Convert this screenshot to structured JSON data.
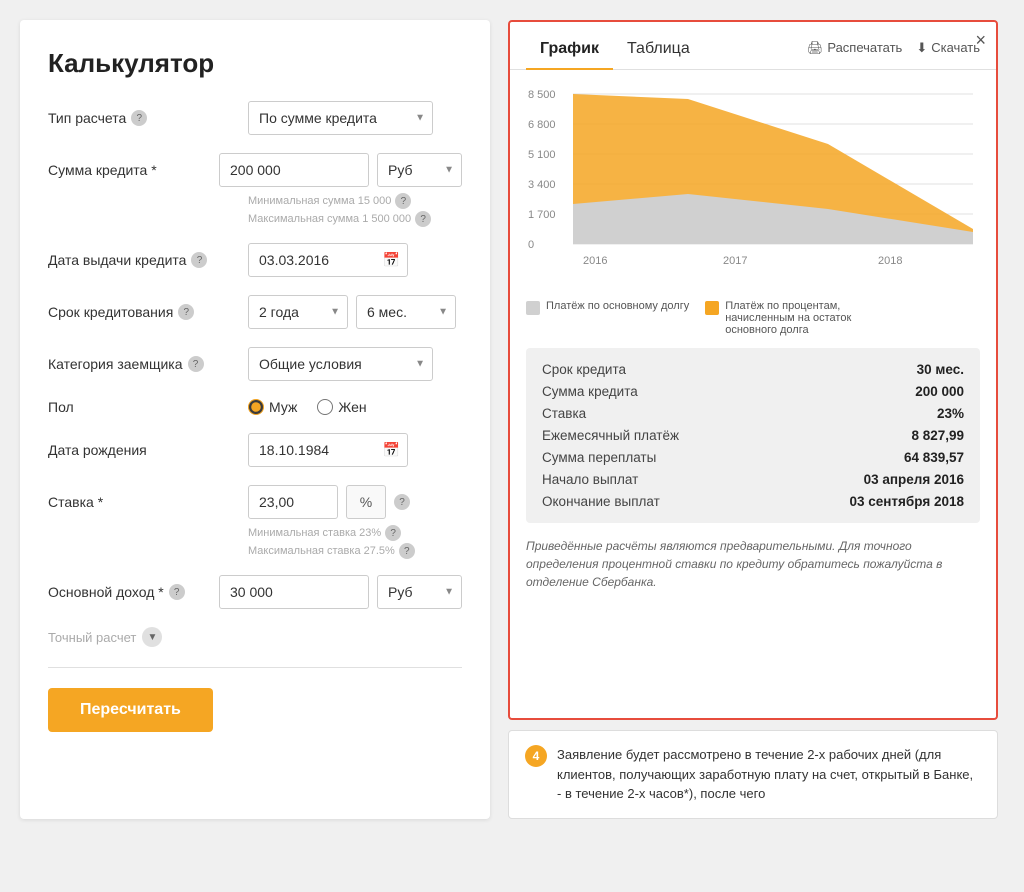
{
  "calculator": {
    "title": "Калькулятор",
    "fields": {
      "calc_type_label": "Тип расчета",
      "calc_type_value": "По сумме кредита",
      "credit_sum_label": "Сумма кредита *",
      "credit_sum_value": "200 000",
      "currency_value": "Руб",
      "min_sum_hint": "Минимальная сумма 15 000",
      "max_sum_hint": "Максимальная сумма 1 500 000",
      "issue_date_label": "Дата выдачи кредита",
      "issue_date_value": "03.03.2016",
      "term_label": "Срок кредитования",
      "term_years_value": "2 года",
      "term_months_value": "6 мес.",
      "category_label": "Категория заемщика",
      "category_value": "Общие условия",
      "gender_label": "Пол",
      "gender_male": "Муж",
      "gender_female": "Жен",
      "birthdate_label": "Дата рождения",
      "birthdate_value": "18.10.1984",
      "rate_label": "Ставка *",
      "rate_value": "23,00",
      "rate_unit": "%",
      "min_rate_hint": "Минимальная ставка 23%",
      "max_rate_hint": "Максимальная ставка 27.5%",
      "income_label": "Основной доход *",
      "income_value": "30 000",
      "income_currency": "Руб",
      "exact_calc_label": "Точный расчет",
      "recalc_btn": "Пересчитать"
    }
  },
  "chart_panel": {
    "close_label": "×",
    "tabs": [
      "График",
      "Таблица"
    ],
    "active_tab": "График",
    "print_label": "Распечатать",
    "download_label": "Скачать",
    "chart": {
      "y_labels": [
        "8 500",
        "6 800",
        "5 100",
        "3 400",
        "1 700",
        "0"
      ],
      "x_labels": [
        "2016",
        "2017",
        "2018"
      ],
      "series": [
        {
          "name": "Платёж по основному долгу",
          "color": "#c8c8c8"
        },
        {
          "name": "Платёж по процентам, начисленным на остаток основного долга",
          "color": "#f5a623"
        }
      ]
    },
    "legend": [
      {
        "label": "Платёж по основному долгу",
        "color": "#d0d0d0"
      },
      {
        "label": "Платёж по процентам, начисленным на остаток основного долга",
        "color": "#f5a623"
      }
    ],
    "summary": {
      "rows": [
        {
          "label": "Срок кредита",
          "value": "30 мес."
        },
        {
          "label": "Сумма кредита",
          "value": "200 000"
        },
        {
          "label": "Ставка",
          "value": "23%"
        },
        {
          "label": "Ежемесячный платёж",
          "value": "8 827,99"
        },
        {
          "label": "Сумма переплаты",
          "value": "64 839,57"
        },
        {
          "label": "Начало выплат",
          "value": "03 апреля 2016"
        },
        {
          "label": "Окончание выплат",
          "value": "03 сентября 2018"
        }
      ]
    },
    "disclaimer": "Приведённые расчёты являются предварительными. Для точного определения процентной ставки по кредиту обратитесь пожалуйста в отделение Сбербанка."
  },
  "notification": {
    "number": "4",
    "text": "Заявление будет рассмотрено в течение 2-х рабочих дней (для клиентов, получающих заработную плату на счет, открытый в Банке, - в течение 2-х часов*), после чего"
  }
}
